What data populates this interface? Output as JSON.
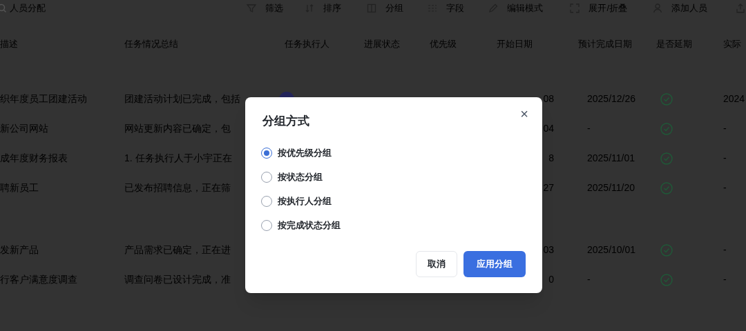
{
  "search": {
    "value": "人员分配"
  },
  "toolbar": [
    {
      "kind": "filter",
      "label": "筛选"
    },
    {
      "kind": "sort",
      "label": "排序"
    },
    {
      "kind": "group",
      "label": "分组"
    },
    {
      "kind": "fields",
      "label": "字段"
    },
    {
      "kind": "edit",
      "label": "编辑模式"
    },
    {
      "kind": "expand",
      "label": "展开/折叠"
    },
    {
      "kind": "person",
      "label": "添加人员"
    },
    {
      "kind": "export"
    }
  ],
  "table": {
    "columns": [
      "描述",
      "任务情况总结",
      "任务执行人",
      "进展状态",
      "优先级",
      "开始日期",
      "预计完成日期",
      "是否延期",
      "实际"
    ],
    "groups": [
      {
        "rows": [
          {
            "description": "织年度员工团建活动",
            "summary": "团建活动计划已完成，包括",
            "avatar": true,
            "start": "08",
            "expected": "2025/12/26",
            "delayed": false,
            "actual": "2024"
          },
          {
            "description": "新公司网站",
            "summary": "网站更新内容已确定，包",
            "avatar": false,
            "start": "04",
            "expected": "-",
            "delayed": false,
            "actual": "-"
          },
          {
            "description": "成年度财务报表",
            "summary": "1. 任务执行人于小宇正在",
            "avatar": false,
            "start": "8",
            "expected": "2025/11/01",
            "delayed": false,
            "actual": "-"
          },
          {
            "description": "聘新员工",
            "summary": "已发布招聘信息，正在筛",
            "avatar": false,
            "start": "27",
            "expected": "2025/11/20",
            "delayed": false,
            "actual": "-"
          }
        ]
      },
      {
        "rows": [
          {
            "description": "发新产品",
            "summary": "产品需求已确定，正在进",
            "avatar": false,
            "start": "03",
            "expected": "2025/10/01",
            "delayed": false,
            "actual": "-"
          },
          {
            "description": "行客户满意度调查",
            "summary": "调查问卷已设计完成，准",
            "avatar": false,
            "start": "0",
            "expected": "-",
            "delayed": false,
            "actual": "-"
          }
        ]
      }
    ]
  },
  "dialog": {
    "title": "分组方式",
    "close": "×",
    "options": [
      {
        "label": "按优先级分组",
        "selected": true
      },
      {
        "label": "按状态分组",
        "selected": false
      },
      {
        "label": "按执行人分组",
        "selected": false
      },
      {
        "label": "按完成状态分组",
        "selected": false
      }
    ],
    "buttons": [
      {
        "kind": "secondary",
        "label": "取消"
      },
      {
        "kind": "primary",
        "label": "应用分组"
      }
    ]
  }
}
